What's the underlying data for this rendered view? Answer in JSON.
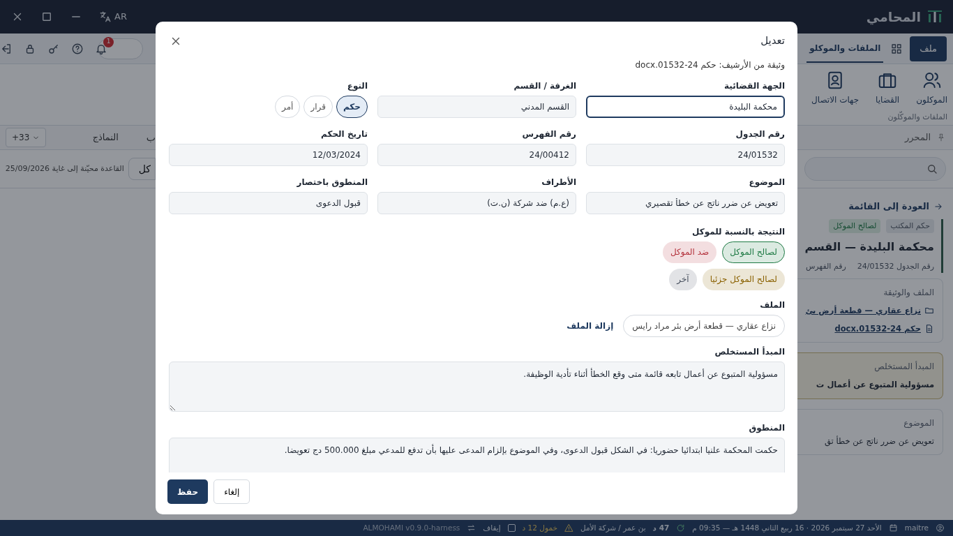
{
  "app": {
    "title": "المحامي",
    "language": "AR"
  },
  "toolbar": {
    "file_button": "ملف",
    "tabs": [
      {
        "label": "الملفات والموكلو",
        "selected": true
      }
    ],
    "notification_count": "1"
  },
  "ribbon": {
    "items": [
      {
        "label": "الموكلون"
      },
      {
        "label": "القضايا"
      },
      {
        "label": "جهات الاتصال"
      }
    ],
    "group_label": "الملفات والموكّلون"
  },
  "left_panel": {
    "tabs": [
      {
        "label": "ب"
      },
      {
        "label": "النماذج"
      }
    ],
    "more_button": "+33",
    "partial_button": "كل",
    "db_status": "القاعدة محيّنة إلى غاية 25/09/2026"
  },
  "right_panel": {
    "section": "المحرر",
    "back_link": "العودة إلى القائمة",
    "tags": [
      {
        "label": "حكم المكتب",
        "kind": "neutral"
      },
      {
        "label": "لصالح الموكل",
        "kind": "success"
      }
    ],
    "title": "محكمة البليدة — القسم",
    "meta": [
      "رقم الجدول 24/01532",
      "رقم الفهرس"
    ],
    "file_card": {
      "title": "الملف والوثيقة",
      "file": "نزاع عقاري — قطعة أرض بئ",
      "document": "حكم 24-01532.docx"
    },
    "principle_card": {
      "title": "المبدأ المستخلص",
      "text": "مسؤولية المتبوع عن أعمال ت"
    },
    "subject_card": {
      "title": "الموضوع",
      "text": "تعويض عن ضرر ناتج عن خطأ تق"
    }
  },
  "dialog": {
    "title": "تعديل",
    "subtitle": "وثيقة من الأرشيف: حكم 24-01532.docx",
    "fields": [
      {
        "kind": "text",
        "label": "الجهة القضائية",
        "value": "محكمة البليدة",
        "focused": true
      },
      {
        "kind": "text",
        "label": "الغرفة / القسم",
        "value": "القسم المدني",
        "focused": false
      },
      {
        "kind": "choice",
        "label": "النوع",
        "options": [
          {
            "label": "حكم",
            "selected": true
          },
          {
            "label": "قرار",
            "selected": false
          },
          {
            "label": "أمر",
            "selected": false
          }
        ]
      },
      {
        "kind": "text",
        "label": "رقم الجدول",
        "value": "24/01532",
        "focused": false
      },
      {
        "kind": "text",
        "label": "رقم الفهرس",
        "value": "24/00412",
        "focused": false
      },
      {
        "kind": "text",
        "label": "تاريخ الحكم",
        "value": "12/03/2024",
        "focused": false
      },
      {
        "kind": "text",
        "label": "الموضوع",
        "value": "تعويض عن ضرر ناتج عن خطأ تقصيري",
        "focused": false
      },
      {
        "kind": "text",
        "label": "الأطراف",
        "value": "(ع.م) ضد شركة (ن.ت)",
        "focused": false
      },
      {
        "kind": "text",
        "label": "المنطوق باختصار",
        "value": "قبول الدعوى",
        "focused": false
      }
    ],
    "outcome": {
      "label": "النتيجة بالنسبة للموكل",
      "options": [
        {
          "label": "لصالح الموكل",
          "color": "#1e7a44",
          "selected": true
        },
        {
          "label": "ضد الموكل",
          "color": "#b4323c",
          "selected": false
        },
        {
          "label": "لصالح الموكل جزئيا",
          "color": "#8a6100",
          "selected": false
        },
        {
          "label": "آخر",
          "color": "#4a5260",
          "selected": false
        }
      ]
    },
    "file": {
      "label": "الملف",
      "value": "نزاع عقاري — قطعة أرض بئر مراد رايس",
      "remove_link": "إزالة الملف"
    },
    "principle": {
      "label": "المبدأ المستخلص",
      "value": "مسؤولية المتبوع عن أعمال تابعه قائمة متى وقع الخطأ أثناء تأدية الوظيفة."
    },
    "ruling": {
      "label": "المنطوق",
      "value": "حكمت المحكمة علنيا ابتدائيا حضوريا: في الشكل قبول الدعوى، وفي الموضوع بإلزام المدعى عليها بأن تدفع للمدعي مبلغ 500.000 دج تعويضا."
    },
    "buttons": [
      {
        "label": "إلغاء",
        "kind": "secondary"
      },
      {
        "label": "حفظ",
        "kind": "primary"
      }
    ]
  },
  "status_bar": {
    "user": "maitre",
    "datetime": "الأحد 27 سبتمبر 2026 · 16 ربيع الثاني 1448 هـ — 09:35 م",
    "sync": "47 د",
    "office": "بن عمر / شركة الأمل",
    "idle": "خمول 12 د",
    "pause": {
      "label": "إيقاف",
      "checked": false
    },
    "version": "ALMOHAMI v0.9.0-harness"
  }
}
